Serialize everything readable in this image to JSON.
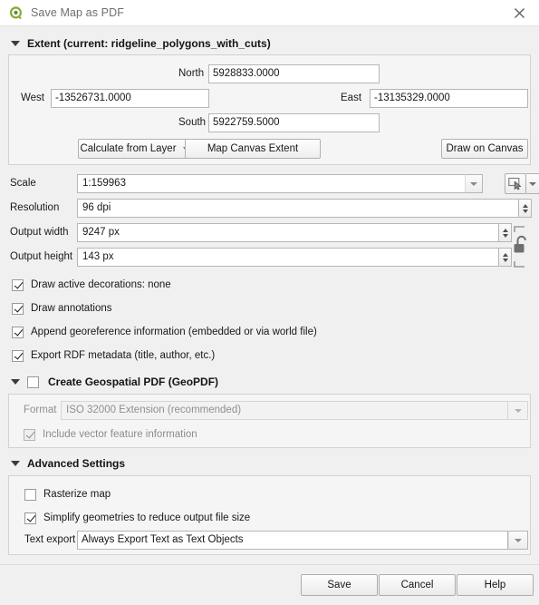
{
  "window": {
    "title": "Save Map as PDF",
    "logo_icon": "qgis-logo-icon",
    "close_icon": "close-icon"
  },
  "extent": {
    "group_title": "Extent (current: ridgeline_polygons_with_cuts)",
    "north_label": "North",
    "north_value": "5928833.0000",
    "west_label": "West",
    "west_value": "-13526731.0000",
    "east_label": "East",
    "east_value": "-13135329.0000",
    "south_label": "South",
    "south_value": "5922759.5000",
    "calculate_from_layer_button": "Calculate from Layer",
    "map_canvas_extent_button": "Map Canvas Extent",
    "draw_on_canvas_button": "Draw on Canvas"
  },
  "output": {
    "scale_label": "Scale",
    "scale_value": "1:159963",
    "scale_pick_icon": "canvas-pick-icon",
    "resolution_label": "Resolution",
    "resolution_value": "96 dpi",
    "output_width_label": "Output width",
    "output_width_value": "9247 px",
    "output_height_label": "Output height",
    "output_height_value": "143 px",
    "lock_icon": "unlocked-padlock-icon"
  },
  "options": [
    {
      "label": "Draw active decorations: none",
      "checked": true
    },
    {
      "label": "Draw annotations",
      "checked": true
    },
    {
      "label": "Append georeference information (embedded or via world file)",
      "checked": true
    },
    {
      "label": "Export RDF metadata (title, author, etc.)",
      "checked": true
    }
  ],
  "geopdf": {
    "group_title": "Create Geospatial PDF (GeoPDF)",
    "enabled": false,
    "format_label": "Format",
    "format_value": "ISO 32000 Extension (recommended)",
    "include_vector_label": "Include vector feature information",
    "include_vector_checked": true
  },
  "advanced": {
    "group_title": "Advanced Settings",
    "rasterize_label": "Rasterize map",
    "rasterize_checked": false,
    "simplify_label": "Simplify geometries to reduce output file size",
    "simplify_checked": true,
    "text_export_label": "Text export",
    "text_export_value": "Always Export Text as Text Objects"
  },
  "footer": {
    "save_label": "Save",
    "cancel_label": "Cancel",
    "help_label": "Help"
  },
  "colors": {
    "accent_green": "#8aa93a",
    "window_bg": "#f0f0f0",
    "group_bg": "#f5f5f5",
    "field_bg": "#ffffff"
  }
}
